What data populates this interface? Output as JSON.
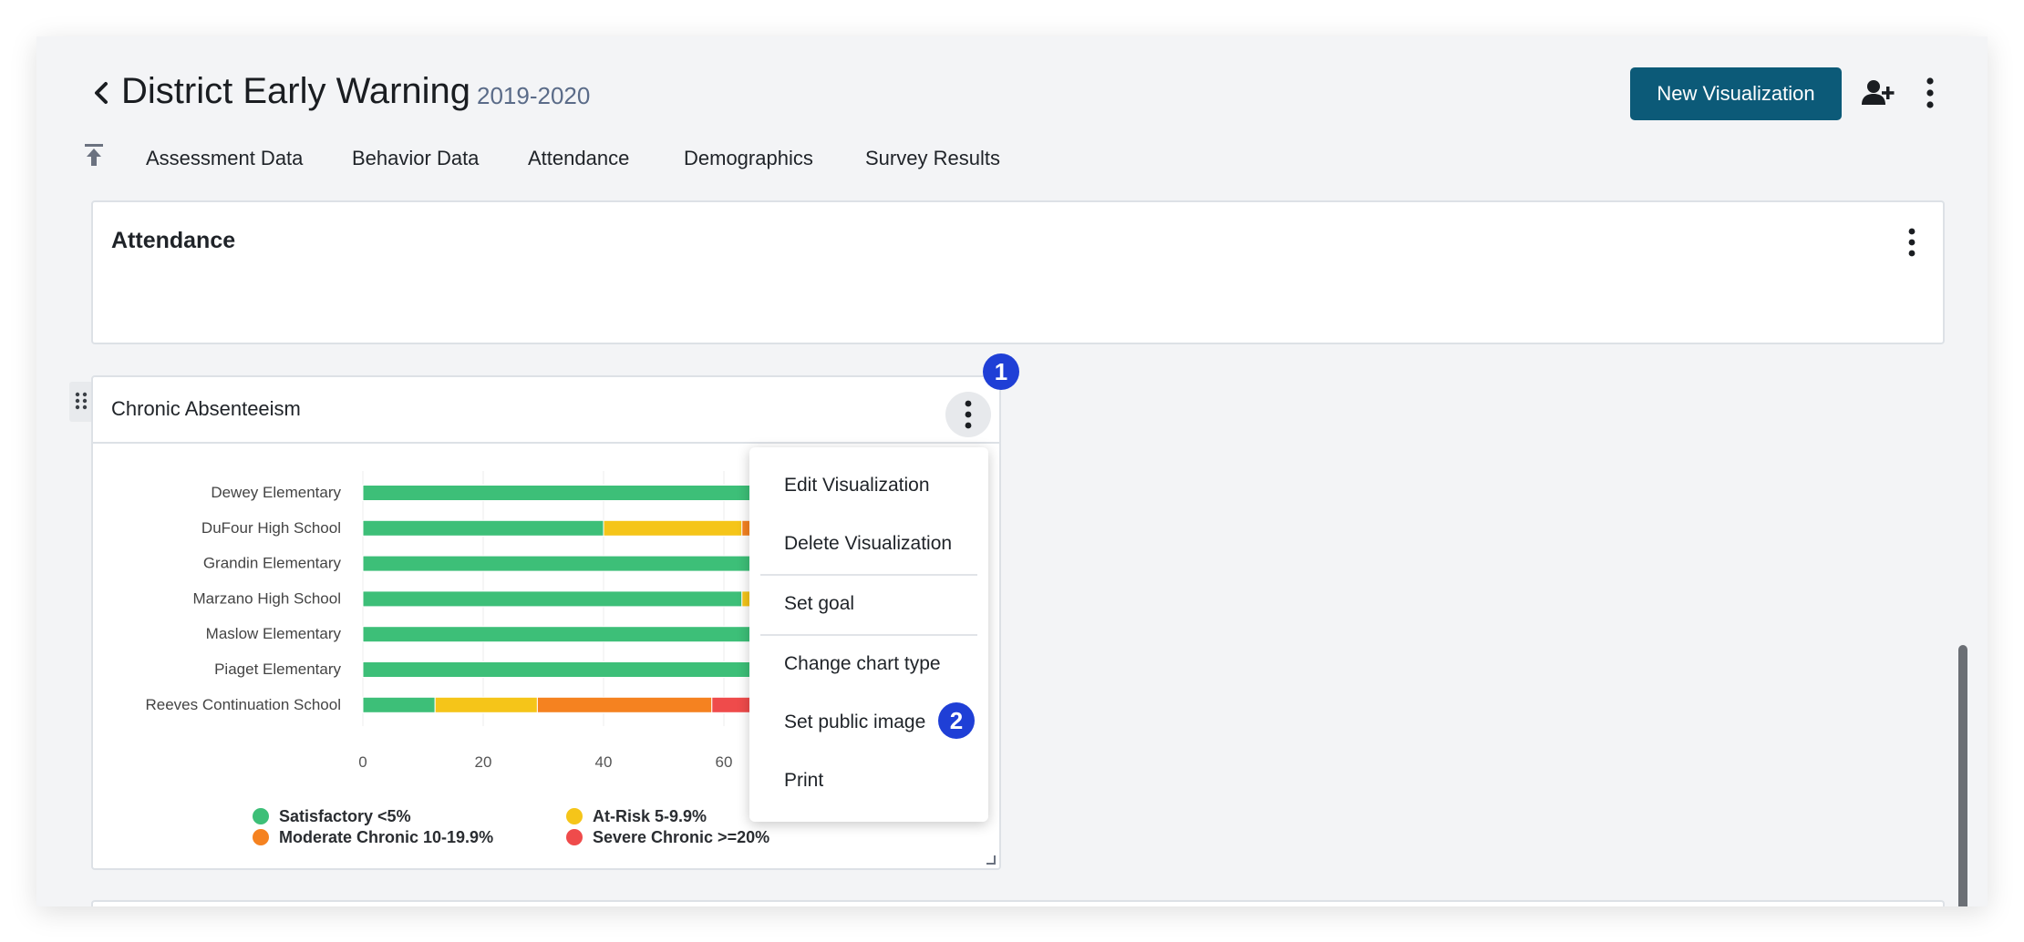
{
  "header": {
    "title": "District Early Warning",
    "year": "2019-2020",
    "new_visualization_label": "New Visualization"
  },
  "tabs": [
    {
      "label": "Assessment Data"
    },
    {
      "label": "Behavior Data"
    },
    {
      "label": "Attendance"
    },
    {
      "label": "Demographics"
    },
    {
      "label": "Survey Results"
    }
  ],
  "attendance_section": {
    "title": "Attendance"
  },
  "chronic_card": {
    "title": "Chronic Absenteeism"
  },
  "menu": {
    "items": [
      {
        "label": "Edit Visualization"
      },
      {
        "label": "Delete Visualization"
      },
      {
        "label": "Set goal"
      },
      {
        "label": "Change chart type"
      },
      {
        "label": "Set public image"
      },
      {
        "label": "Print"
      }
    ]
  },
  "callouts": {
    "one": "1",
    "two": "2"
  },
  "chart_data": {
    "type": "bar",
    "orientation": "horizontal",
    "stacked": true,
    "categories": [
      "Dewey Elementary",
      "DuFour High School",
      "Grandin Elementary",
      "Marzano High School",
      "Maslow Elementary",
      "Piaget Elementary",
      "Reeves Continuation School"
    ],
    "series": [
      {
        "name": "Satisfactory <5%",
        "color": "#3dbf78",
        "values": [
          100,
          40,
          100,
          63,
          100,
          100,
          12
        ]
      },
      {
        "name": "At-Risk 5-9.9%",
        "color": "#f5c519",
        "values": [
          0,
          23,
          0,
          2,
          0,
          0,
          17
        ]
      },
      {
        "name": "Moderate Chronic 10-19.9%",
        "color": "#f58220",
        "values": [
          0,
          24,
          0,
          20,
          0,
          0,
          29
        ]
      },
      {
        "name": "Severe Chronic >=20%",
        "color": "#ef4b4b",
        "values": [
          0,
          13,
          0,
          15,
          0,
          0,
          42
        ]
      }
    ],
    "xticks": [
      0,
      20,
      40,
      60
    ],
    "xlim": [
      0,
      100
    ],
    "grid": true,
    "legend_position": "bottom"
  }
}
